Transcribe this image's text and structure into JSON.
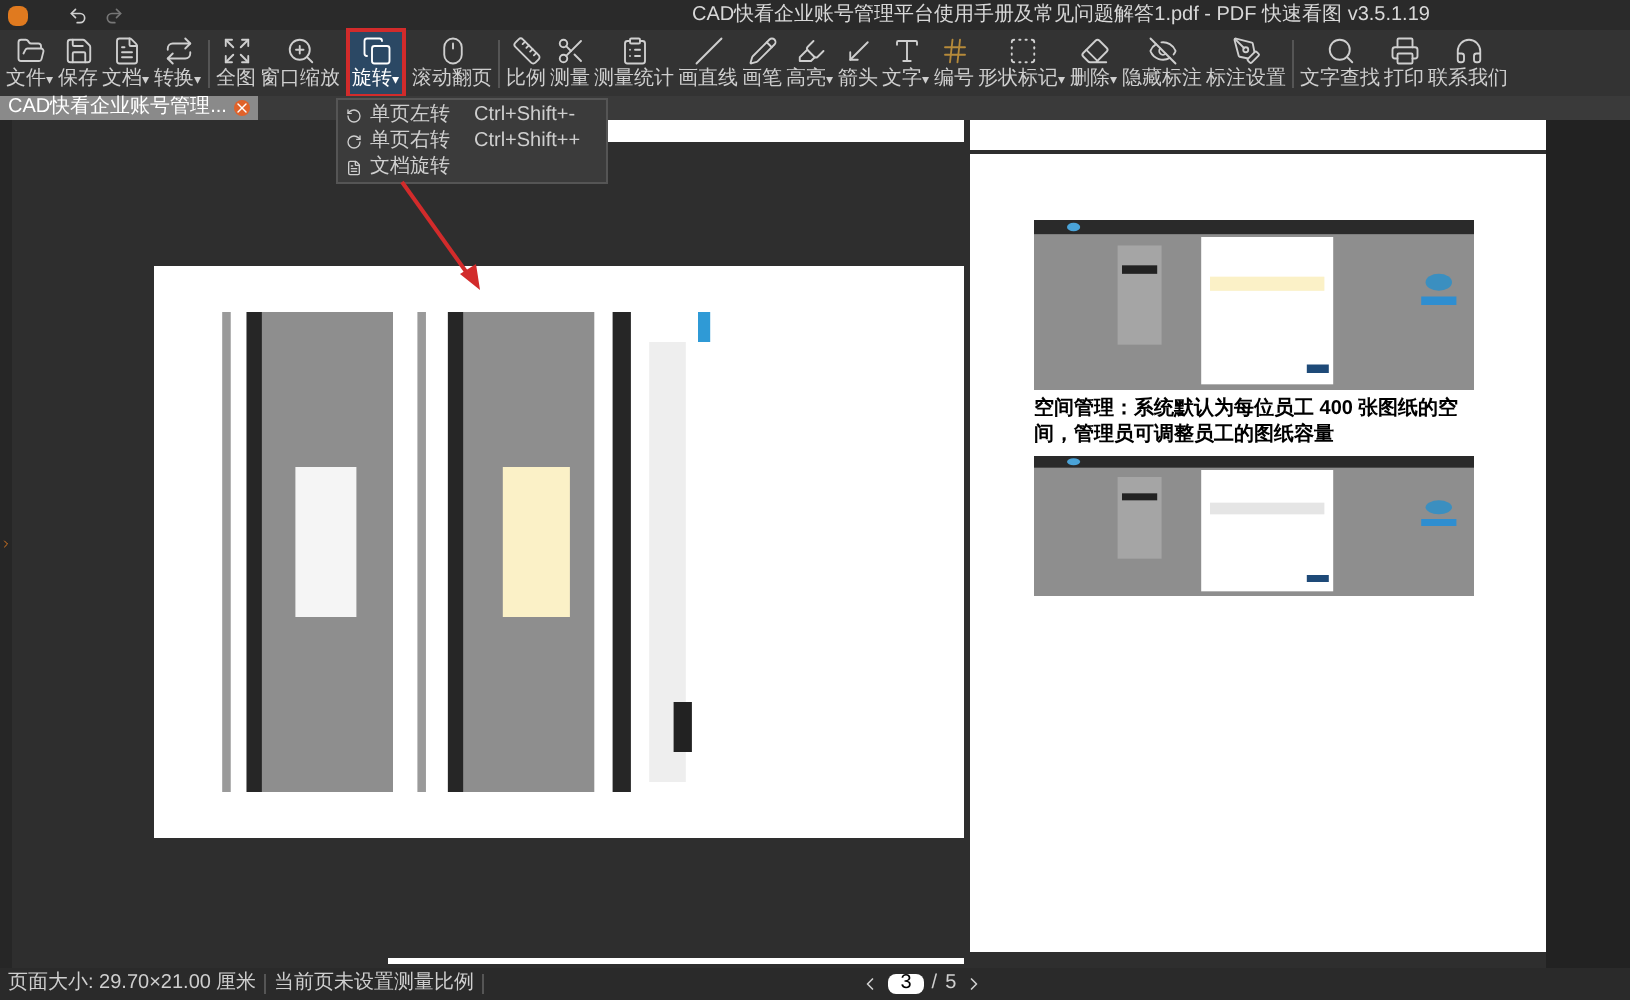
{
  "window": {
    "title": "CAD快看企业账号管理平台使用手册及常见问题解答1.pdf - PDF 快速看图 v3.5.1.19"
  },
  "toolbar": {
    "groups": [
      [
        {
          "label": "文件",
          "menu": true,
          "selected": false
        },
        {
          "label": "保存",
          "menu": false,
          "selected": false
        },
        {
          "label": "文档",
          "menu": true,
          "selected": false
        },
        {
          "label": "转换",
          "menu": true,
          "selected": false
        }
      ],
      [
        {
          "label": "全图",
          "menu": false,
          "selected": false
        },
        {
          "label": "窗口缩放",
          "menu": false,
          "selected": false
        },
        {
          "label": "旋转",
          "menu": true,
          "selected": true
        },
        {
          "label": "滚动翻页",
          "menu": false,
          "selected": false
        }
      ],
      [
        {
          "label": "比例",
          "menu": false,
          "selected": false
        },
        {
          "label": "测量",
          "menu": false,
          "selected": false
        },
        {
          "label": "测量统计",
          "menu": false,
          "selected": false
        },
        {
          "label": "画直线",
          "menu": false,
          "selected": false
        },
        {
          "label": "画笔",
          "menu": false,
          "selected": false
        },
        {
          "label": "高亮",
          "menu": true,
          "selected": false
        },
        {
          "label": "箭头",
          "menu": false,
          "selected": false
        },
        {
          "label": "文字",
          "menu": true,
          "selected": false
        },
        {
          "label": "编号",
          "menu": false,
          "selected": false
        },
        {
          "label": "形状标记",
          "menu": true,
          "selected": false
        },
        {
          "label": "删除",
          "menu": true,
          "selected": false
        },
        {
          "label": "隐藏标注",
          "menu": false,
          "selected": false
        },
        {
          "label": "标注设置",
          "menu": false,
          "selected": false
        }
      ],
      [
        {
          "label": "文字查找",
          "menu": false,
          "selected": false
        },
        {
          "label": "打印",
          "menu": false,
          "selected": false
        },
        {
          "label": "联系我们",
          "menu": false,
          "selected": false
        }
      ]
    ],
    "menu_caret": "▾"
  },
  "tabs": [
    {
      "label": "CAD快看企业账号管理...",
      "selected": true
    }
  ],
  "rotate_menu": {
    "items": [
      {
        "label": "单页左转",
        "shortcut": "Ctrl+Shift+-"
      },
      {
        "label": "单页右转",
        "shortcut": "Ctrl+Shift++"
      },
      {
        "label": "文档旋转"
      }
    ]
  },
  "document": {
    "caption": "空间管理：系统默认为每位员工 400 张图纸的空间，管理员可调整员工的图纸容量"
  },
  "status_bar": {
    "page_size": "页面大小: 29.70×21.00 厘米",
    "scale_note": "当前页未设置测量比例",
    "current_page": "3",
    "separator": "/",
    "total_pages": "5"
  }
}
